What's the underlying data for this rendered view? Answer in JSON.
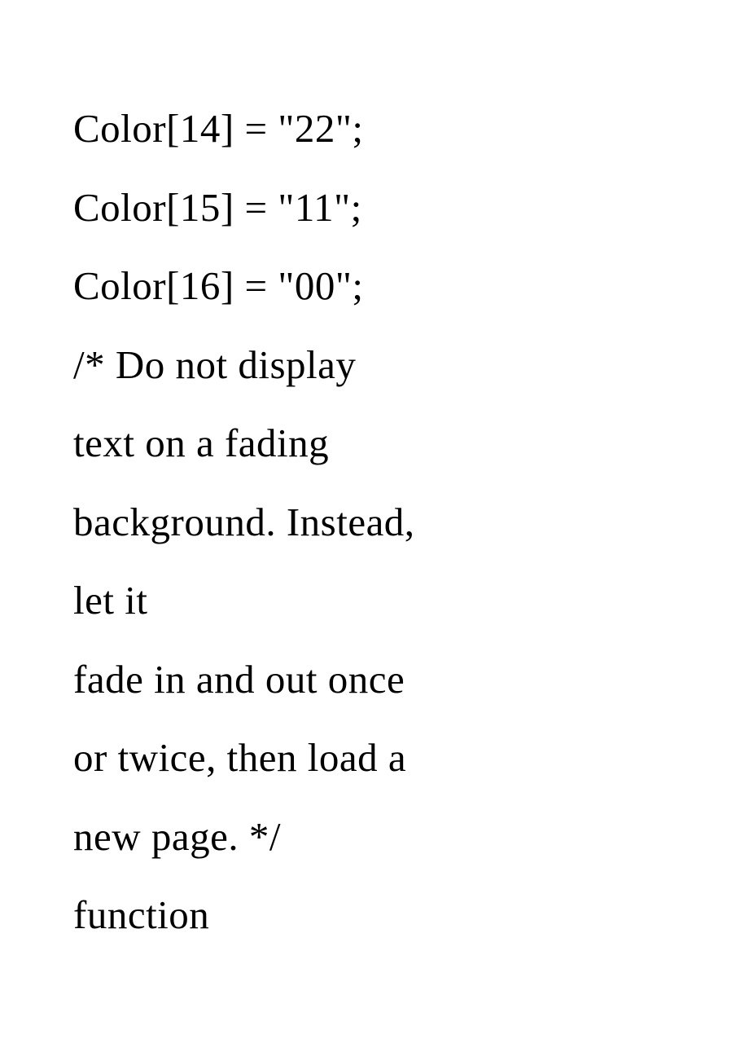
{
  "lines": [
    "Color[14] = \"22\";",
    "Color[15] = \"11\";",
    "Color[16] = \"00\";",
    "/* Do not display",
    "text on a fading",
    "background. Instead,",
    "let it",
    "fade in and out once",
    "or twice, then load a",
    "new page. */",
    "function"
  ]
}
